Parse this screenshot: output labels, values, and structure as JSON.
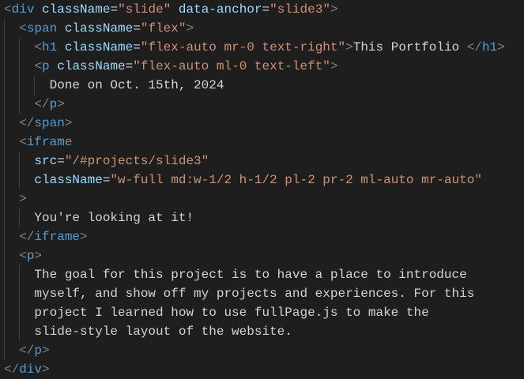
{
  "colors": {
    "background": "#1e1e1e",
    "tag": "#569cd6",
    "attribute": "#9cdcfe",
    "string": "#ce9178",
    "punctuation": "#808080",
    "text": "#d4d4d4"
  },
  "lines": [
    {
      "indent": 0,
      "tokens": [
        [
          "punc",
          "<"
        ],
        [
          "tag",
          "div"
        ],
        [
          "text",
          " "
        ],
        [
          "attr",
          "className"
        ],
        [
          "eq",
          "="
        ],
        [
          "str",
          "\"slide\""
        ],
        [
          "text",
          " "
        ],
        [
          "attr",
          "data-anchor"
        ],
        [
          "eq",
          "="
        ],
        [
          "str",
          "\"slide3\""
        ],
        [
          "punc",
          ">"
        ]
      ]
    },
    {
      "indent": 1,
      "tokens": [
        [
          "punc",
          "<"
        ],
        [
          "tag",
          "span"
        ],
        [
          "text",
          " "
        ],
        [
          "attr",
          "className"
        ],
        [
          "eq",
          "="
        ],
        [
          "str",
          "\"flex\""
        ],
        [
          "punc",
          ">"
        ]
      ]
    },
    {
      "indent": 2,
      "tokens": [
        [
          "punc",
          "<"
        ],
        [
          "tag",
          "h1"
        ],
        [
          "text",
          " "
        ],
        [
          "attr",
          "className"
        ],
        [
          "eq",
          "="
        ],
        [
          "str",
          "\"flex-auto mr-0 text-right\""
        ],
        [
          "punc",
          ">"
        ],
        [
          "text",
          "This Portfolio "
        ],
        [
          "punc",
          "</"
        ],
        [
          "tag",
          "h1"
        ],
        [
          "punc",
          ">"
        ]
      ]
    },
    {
      "indent": 2,
      "tokens": [
        [
          "punc",
          "<"
        ],
        [
          "tag",
          "p"
        ],
        [
          "text",
          " "
        ],
        [
          "attr",
          "className"
        ],
        [
          "eq",
          "="
        ],
        [
          "str",
          "\"flex-auto ml-0 text-left\""
        ],
        [
          "punc",
          ">"
        ]
      ]
    },
    {
      "indent": 3,
      "tokens": [
        [
          "text",
          "Done on Oct. 15th, 2024"
        ]
      ]
    },
    {
      "indent": 2,
      "tokens": [
        [
          "punc",
          "</"
        ],
        [
          "tag",
          "p"
        ],
        [
          "punc",
          ">"
        ]
      ]
    },
    {
      "indent": 1,
      "tokens": [
        [
          "punc",
          "</"
        ],
        [
          "tag",
          "span"
        ],
        [
          "punc",
          ">"
        ]
      ]
    },
    {
      "indent": 1,
      "tokens": [
        [
          "punc",
          "<"
        ],
        [
          "tag",
          "iframe"
        ]
      ]
    },
    {
      "indent": 2,
      "tokens": [
        [
          "attr",
          "src"
        ],
        [
          "eq",
          "="
        ],
        [
          "str",
          "\"/#projects/slide3\""
        ]
      ]
    },
    {
      "indent": 2,
      "tokens": [
        [
          "attr",
          "className"
        ],
        [
          "eq",
          "="
        ],
        [
          "str",
          "\"w-full md:w-1/2 h-1/2 pl-2 pr-2 ml-auto mr-auto\""
        ]
      ]
    },
    {
      "indent": 1,
      "tokens": [
        [
          "punc",
          ">"
        ]
      ]
    },
    {
      "indent": 2,
      "tokens": [
        [
          "text",
          "You're looking at it!"
        ]
      ]
    },
    {
      "indent": 1,
      "tokens": [
        [
          "punc",
          "</"
        ],
        [
          "tag",
          "iframe"
        ],
        [
          "punc",
          ">"
        ]
      ]
    },
    {
      "indent": 1,
      "tokens": [
        [
          "punc",
          "<"
        ],
        [
          "tag",
          "p"
        ],
        [
          "punc",
          ">"
        ]
      ]
    },
    {
      "indent": 2,
      "tokens": [
        [
          "text",
          "The goal for this project is to have a place to introduce"
        ]
      ]
    },
    {
      "indent": 2,
      "tokens": [
        [
          "text",
          "myself, and show off my projects and experiences. For this"
        ]
      ]
    },
    {
      "indent": 2,
      "tokens": [
        [
          "text",
          "project I learned how to use fullPage.js to make the"
        ]
      ]
    },
    {
      "indent": 2,
      "tokens": [
        [
          "text",
          "slide-style layout of the website."
        ]
      ]
    },
    {
      "indent": 1,
      "tokens": [
        [
          "punc",
          "</"
        ],
        [
          "tag",
          "p"
        ],
        [
          "punc",
          ">"
        ]
      ]
    },
    {
      "indent": 0,
      "tokens": [
        [
          "punc",
          "</"
        ],
        [
          "tag",
          "div"
        ],
        [
          "punc",
          ">"
        ]
      ]
    }
  ]
}
